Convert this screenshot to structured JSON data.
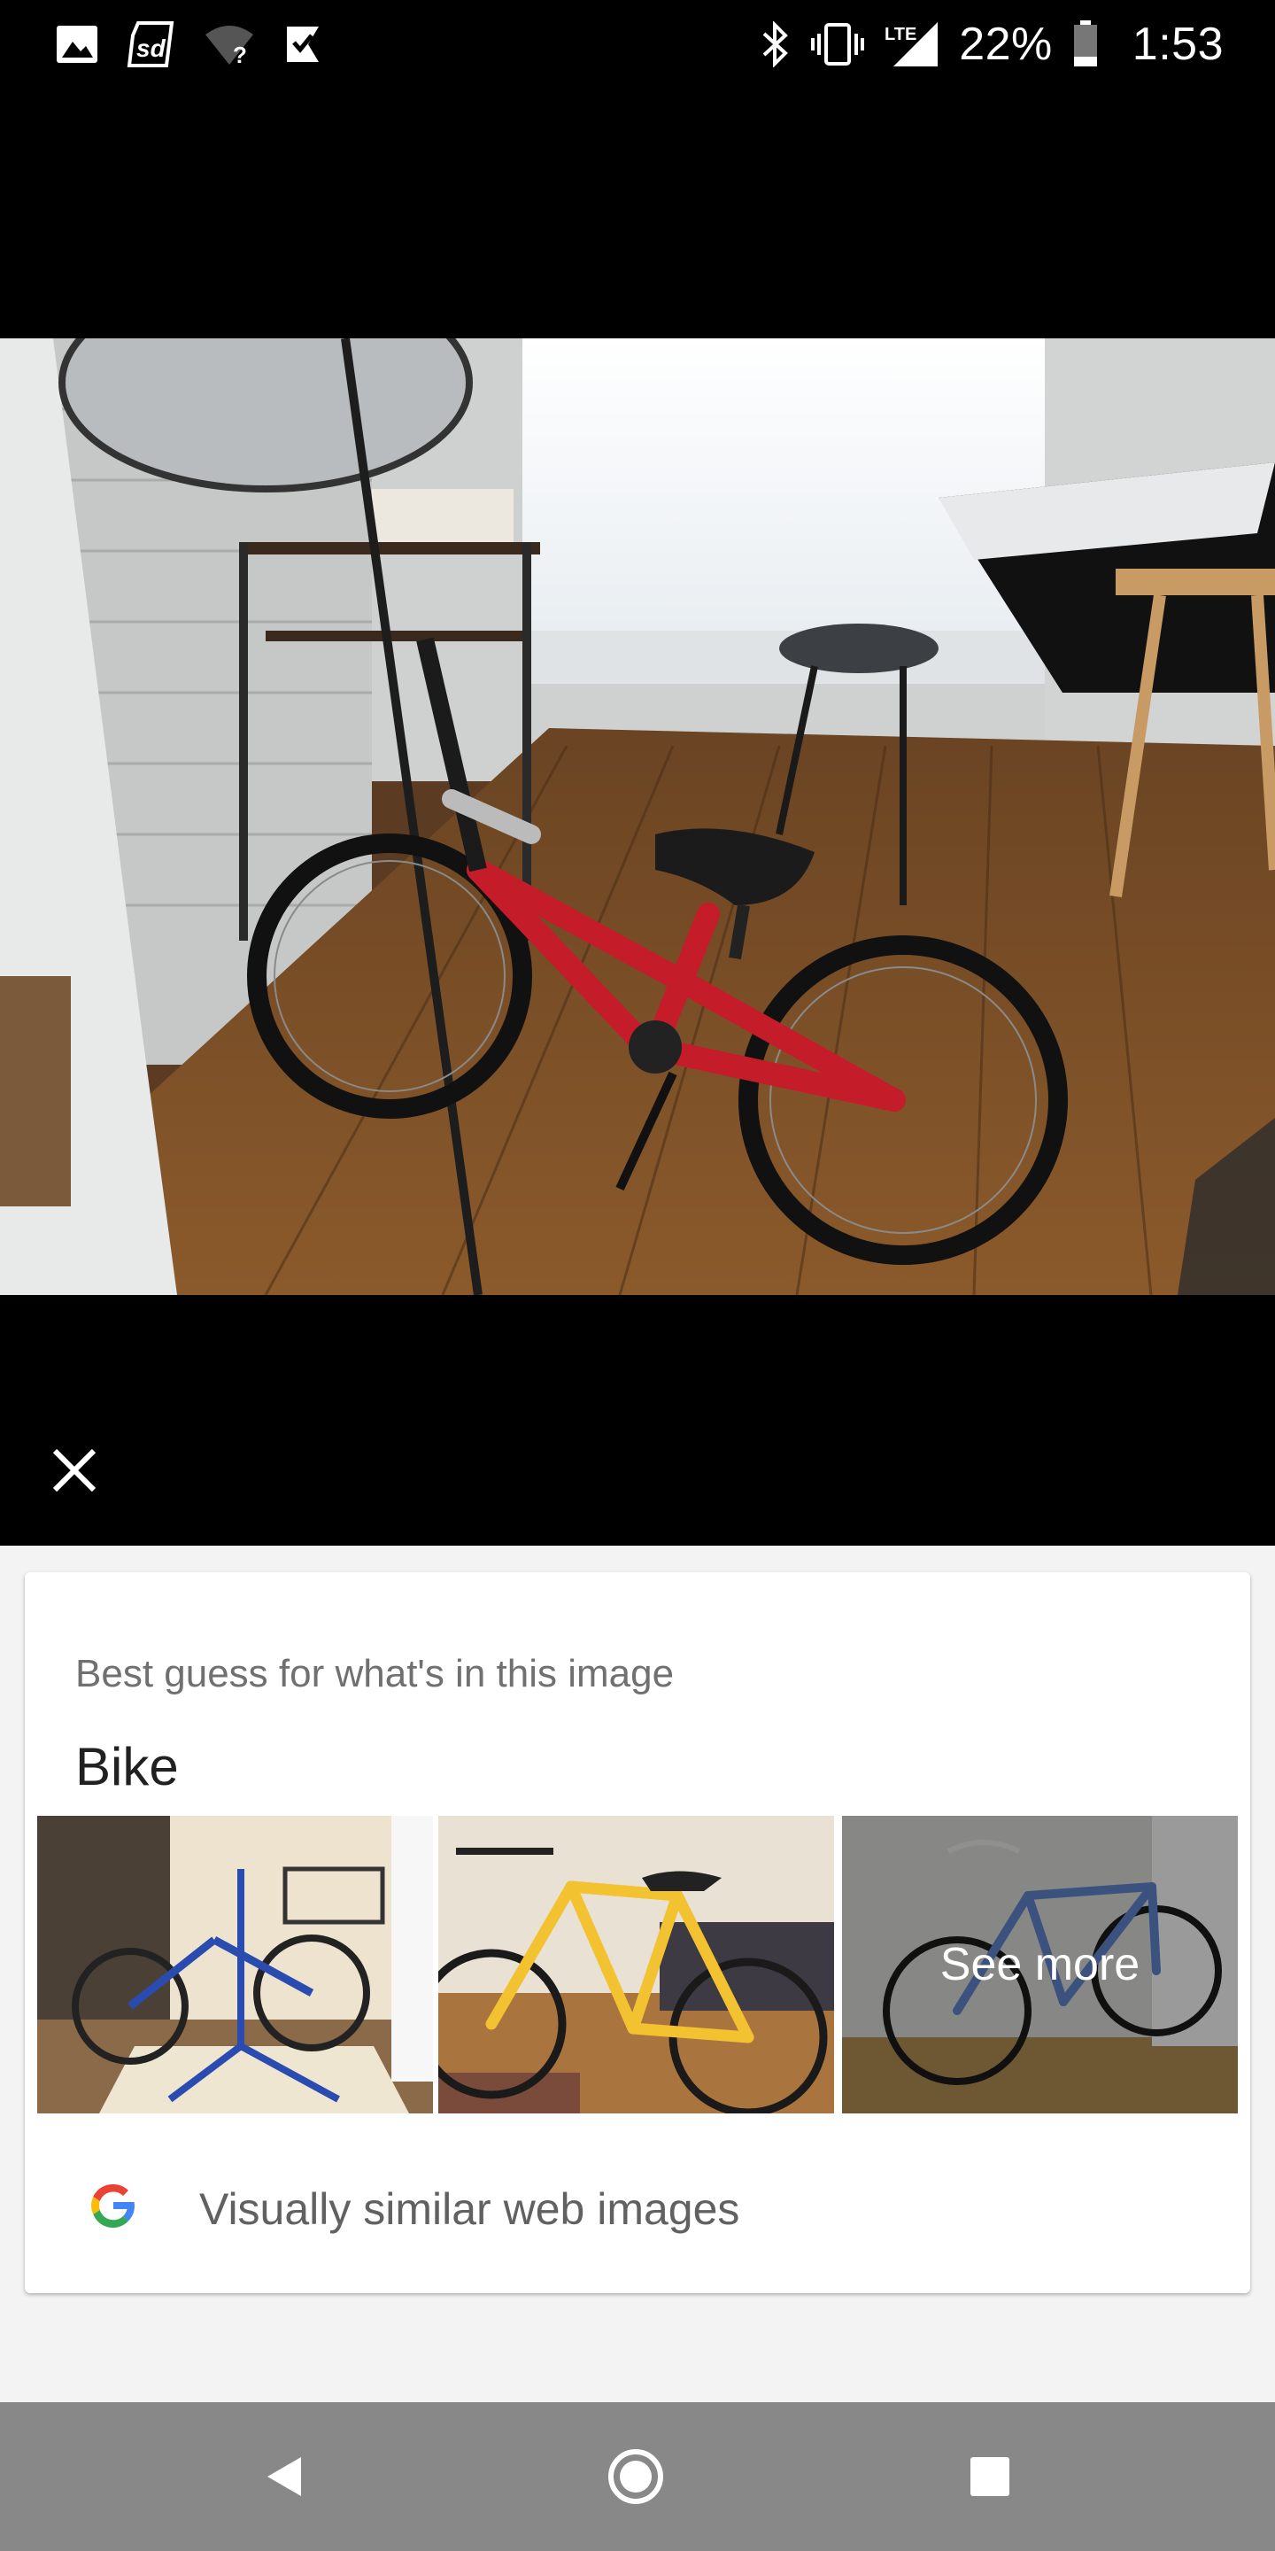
{
  "status_bar": {
    "battery": "22%",
    "time": "1:53",
    "network": "LTE",
    "left_icons": [
      "image-icon",
      "sd-card-icon",
      "wifi-unknown-icon",
      "check-notification-icon"
    ],
    "right_icons": [
      "bluetooth-icon",
      "vibrate-icon",
      "lte-signal-icon",
      "battery-icon"
    ]
  },
  "viewer": {
    "close_icon": "close-icon"
  },
  "result_card": {
    "caption": "Best guess for what's in this image",
    "title": "Bike",
    "thumbnails": [
      {
        "subject": "blue bike on repair stand"
      },
      {
        "subject": "yellow road bike"
      },
      {
        "subject": "blue road bike"
      }
    ],
    "see_more_label": "See more",
    "similar_label": "Visually similar web images"
  },
  "nav_bar": {
    "back_icon": "back-icon",
    "home_icon": "home-icon",
    "recents_icon": "recents-icon"
  }
}
